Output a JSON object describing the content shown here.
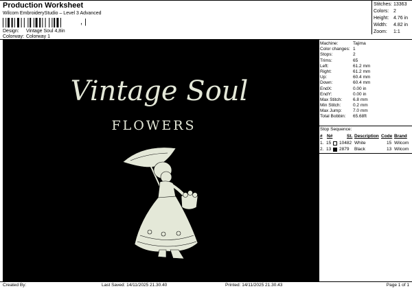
{
  "header": {
    "title": "Production Worksheet",
    "subtitle": "Wilcom EmbroideryStudio – Level 3 Advanced",
    "barcode_suffix": ", |"
  },
  "meta": {
    "design_label": "Design:",
    "design_value": "Vintage Soul 4,8in",
    "colorway_label": "Colorway:",
    "colorway_value": "Colorway 1"
  },
  "summary": [
    {
      "label": "Stitches:",
      "value": "13363"
    },
    {
      "label": "Colors:",
      "value": "2"
    },
    {
      "label": "Height:",
      "value": "4.76 in"
    },
    {
      "label": "Width:",
      "value": "4.82 in"
    },
    {
      "label": "Zoom:",
      "value": "1:1"
    }
  ],
  "artwork": {
    "line1": "Vintage Soul",
    "line2": "FLOWERS",
    "background_color": "#000000",
    "thread_color": "#e4e8d8",
    "figure": "girl-with-parasol-and-flower-basket"
  },
  "specs": [
    {
      "label": "Machine:",
      "value": "Tajima"
    },
    {
      "label": "Color changes:",
      "value": "1"
    },
    {
      "label": "Stops:",
      "value": "2"
    },
    {
      "label": "Trims:",
      "value": "65"
    },
    {
      "label": "Left:",
      "value": "61.2 mm"
    },
    {
      "label": "Right:",
      "value": "61.2 mm"
    },
    {
      "label": "Up:",
      "value": "60.4 mm"
    },
    {
      "label": "Down:",
      "value": "60.4 mm"
    },
    {
      "label": "EndX:",
      "value": "0.00 in"
    },
    {
      "label": "EndY:",
      "value": "0.00 in"
    },
    {
      "label": "Max Stitch:",
      "value": "6.8 mm"
    },
    {
      "label": "Min Stitch:",
      "value": "0.2 mm"
    },
    {
      "label": "Max Jump:",
      "value": "7.0 mm"
    },
    {
      "label": "Total Bobbin:",
      "value": "65.68ft"
    }
  ],
  "stop_sequence": {
    "title": "Stop Sequence:",
    "columns": [
      "#",
      "N#",
      "St.",
      "Description",
      "Code",
      "Brand"
    ],
    "rows": [
      {
        "index": "1.",
        "needle": "15",
        "stitches": "10482",
        "description": "White",
        "code": "15",
        "brand": "Wilcom",
        "color": "#ffffff"
      },
      {
        "index": "2.",
        "needle": "13",
        "stitches": "2879",
        "description": "Black",
        "code": "13",
        "brand": "Wilcom",
        "color": "#000000"
      }
    ]
  },
  "footer": {
    "created_by": "Created By:",
    "last_saved": "Last Saved: 14/11/2025 21.30.40",
    "printed": "Printed: 14/11/2025 21.30.43",
    "page": "Page 1 of 1"
  }
}
